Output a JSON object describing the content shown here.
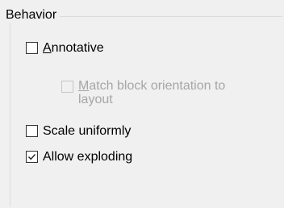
{
  "group": {
    "title": "Behavior"
  },
  "checkboxes": [
    {
      "mnemonic": "A",
      "rest": "nnotative",
      "checked": false,
      "enabled": true
    },
    {
      "line1_mnemonic": "M",
      "line1_rest": "atch block orientation to",
      "line2": "layout",
      "checked": false,
      "enabled": false
    },
    {
      "label": "Scale uniformly",
      "checked": false,
      "enabled": true
    },
    {
      "label": "Allow exploding",
      "checked": true,
      "enabled": true
    }
  ]
}
